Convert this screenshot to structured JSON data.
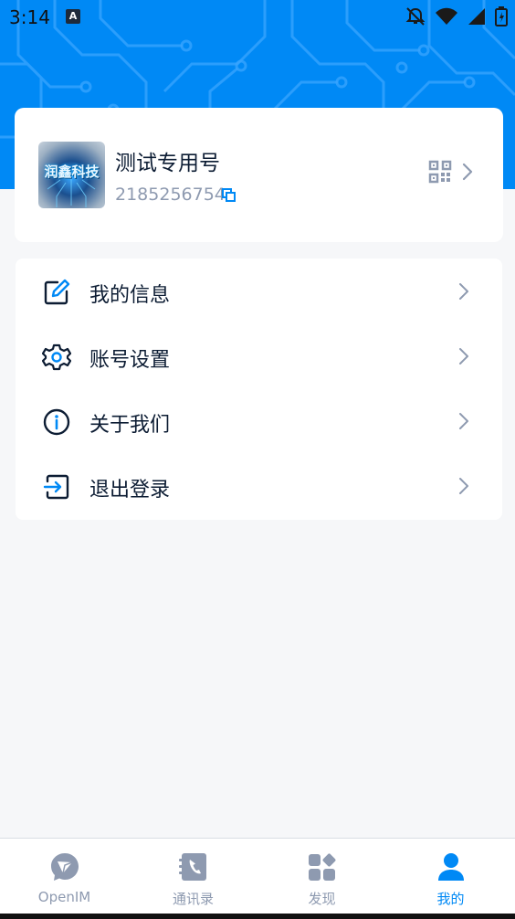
{
  "status_bar": {
    "time": "3:14",
    "notification_badge": "A"
  },
  "profile": {
    "name": "测试专用号",
    "user_id": "2185256754",
    "avatar_text": "润鑫科技"
  },
  "menu": [
    {
      "id": "my-info",
      "label": "我的信息",
      "icon": "edit-icon"
    },
    {
      "id": "account-settings",
      "label": "账号设置",
      "icon": "gear-icon"
    },
    {
      "id": "about-us",
      "label": "关于我们",
      "icon": "info-icon"
    },
    {
      "id": "logout",
      "label": "退出登录",
      "icon": "logout-icon"
    }
  ],
  "tabs": [
    {
      "id": "openim",
      "label": "OpenIM",
      "icon": "chat-logo-icon",
      "active": false
    },
    {
      "id": "contacts",
      "label": "通讯录",
      "icon": "contacts-book-icon",
      "active": false
    },
    {
      "id": "discover",
      "label": "发现",
      "icon": "apps-grid-icon",
      "active": false
    },
    {
      "id": "mine",
      "label": "我的",
      "icon": "person-icon",
      "active": true
    }
  ],
  "colors": {
    "brand_blue": "#0089f5",
    "text_dark": "#0c1c33",
    "text_gray": "#8e9ab0",
    "page_bg": "#f6f7f9"
  }
}
